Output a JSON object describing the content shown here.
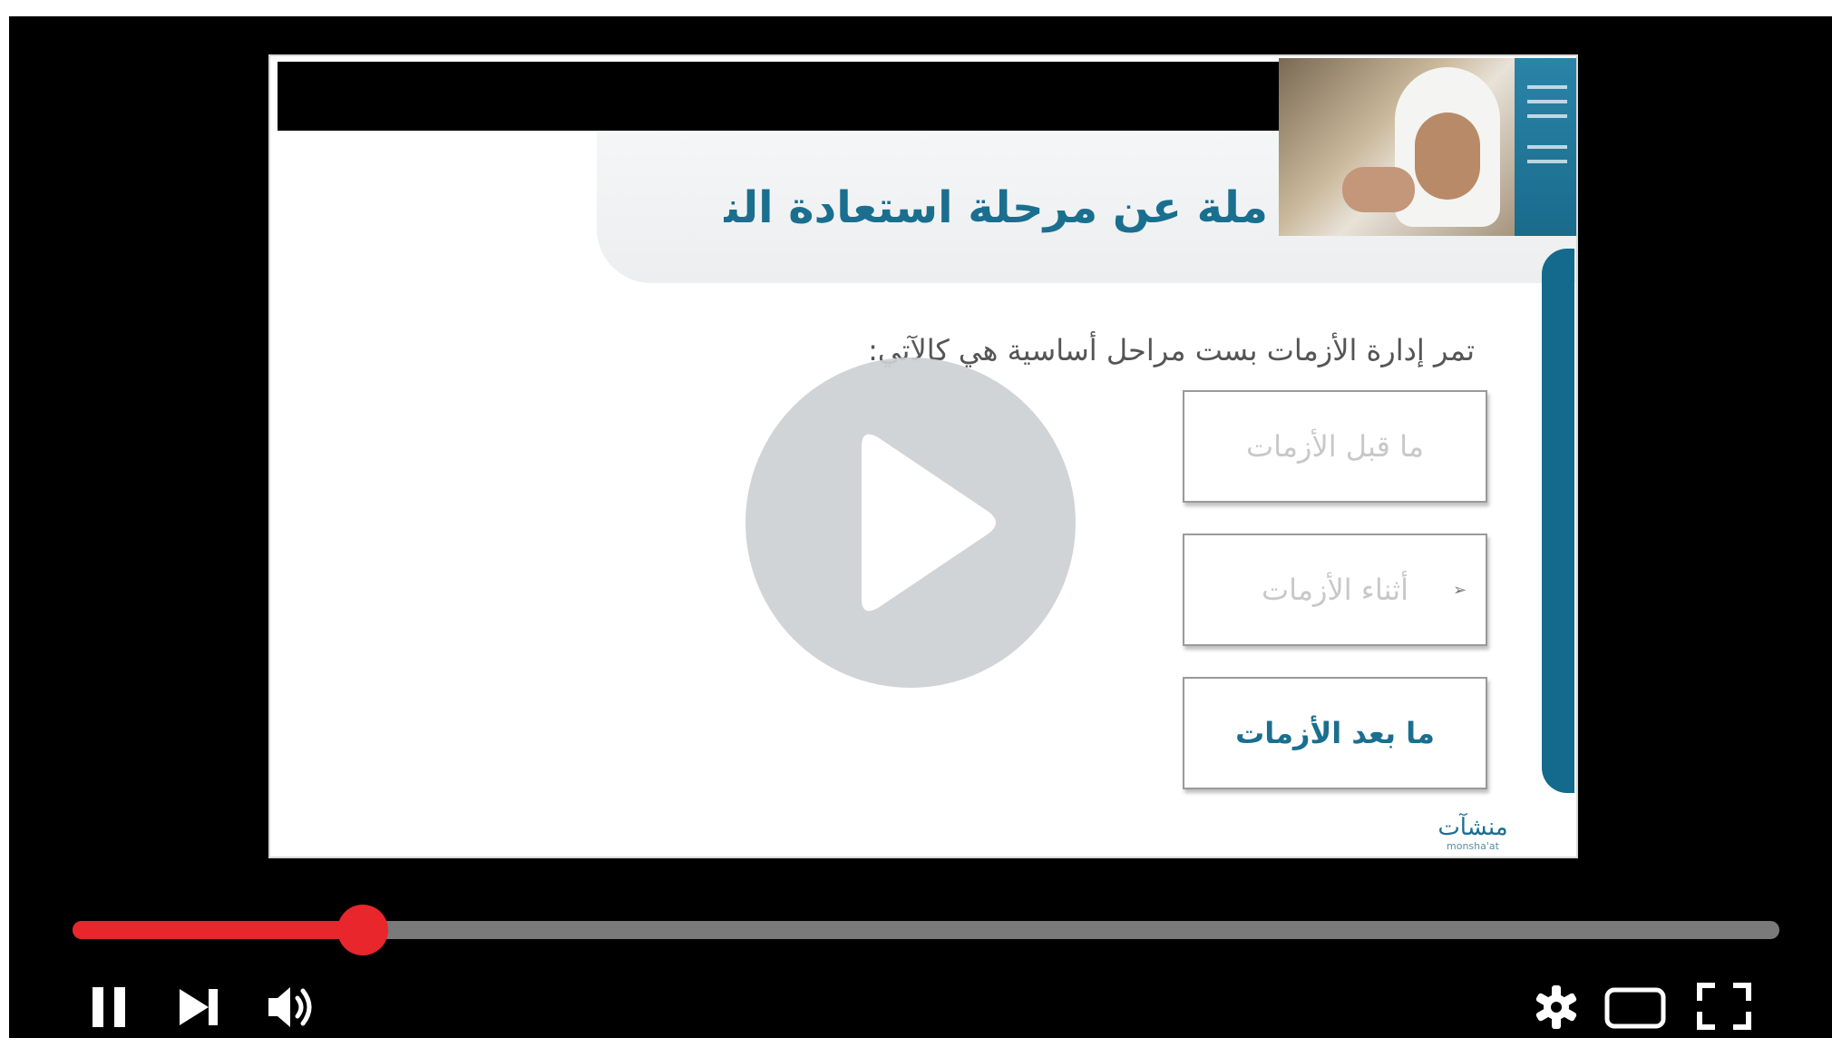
{
  "slide": {
    "title": "ملة عن مرحلة استعادة النشاط",
    "intro": "تمر إدارة الأزمات بست مراحل أساسية هي كالآتي:",
    "stages": [
      {
        "label": "ما قبل الأزمات",
        "state": "faded"
      },
      {
        "label": "أثناء الأزمات",
        "state": "faded"
      },
      {
        "label": "ما بعد الأزمات",
        "state": "active"
      }
    ],
    "logo": {
      "arabic": "منشآت",
      "latin": "monsha'at"
    }
  },
  "player": {
    "progress_fraction": 0.17,
    "play_overlay_icon": "play-icon",
    "controls_left": [
      "pause-icon",
      "skip-next-icon",
      "volume-icon"
    ],
    "controls_right": [
      "settings-icon",
      "theater-mode-icon",
      "fullscreen-icon"
    ]
  },
  "colors": {
    "accent_red": "#e8262b",
    "slide_teal": "#1a6f8f",
    "track_gray": "#7a7a7a"
  }
}
